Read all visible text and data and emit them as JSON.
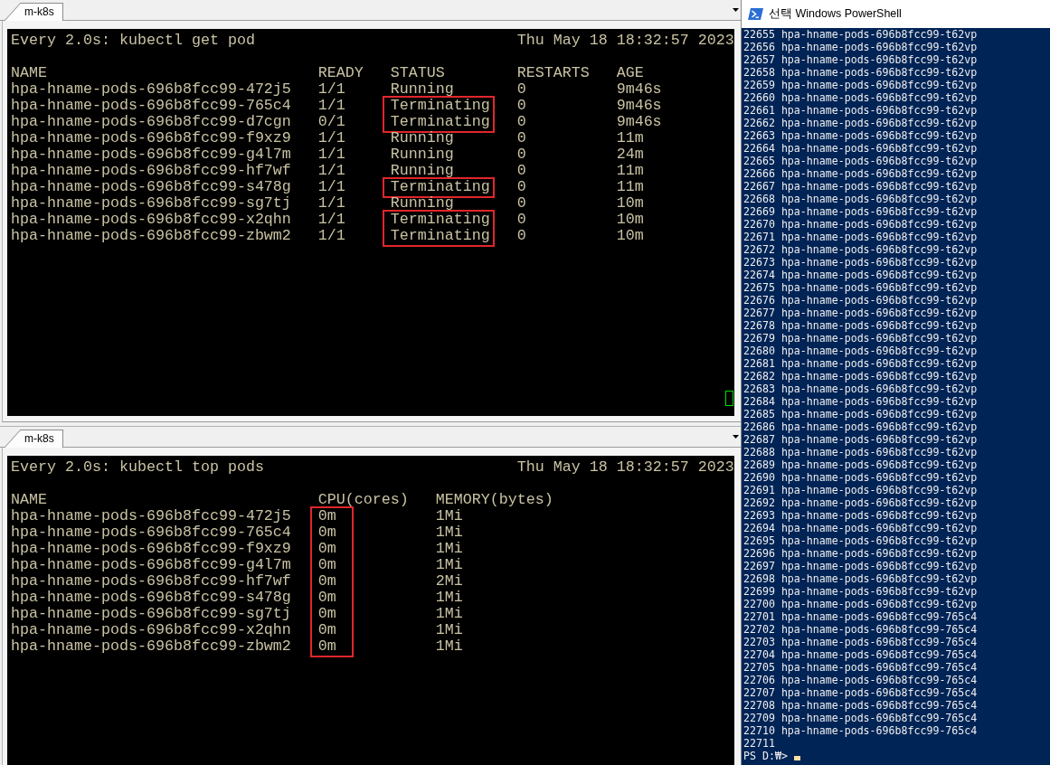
{
  "panes": [
    {
      "tab": "m-k8s",
      "command": "Every 2.0s: kubectl get pod",
      "timestamp": "Thu May 18 18:32:57 2023",
      "cursor_visible": true,
      "columns": [
        "NAME",
        "READY",
        "STATUS",
        "RESTARTS",
        "AGE"
      ],
      "rows": [
        {
          "cells": [
            "hpa-hname-pods-696b8fcc99-472j5",
            "1/1",
            "Running",
            "0",
            "9m46s"
          ],
          "highlighted": [
            false,
            false,
            false,
            false,
            false
          ]
        },
        {
          "cells": [
            "hpa-hname-pods-696b8fcc99-765c4",
            "1/1",
            "Terminating",
            "0",
            "9m46s"
          ],
          "highlighted": [
            false,
            false,
            true,
            false,
            false
          ]
        },
        {
          "cells": [
            "hpa-hname-pods-696b8fcc99-d7cgn",
            "0/1",
            "Terminating",
            "0",
            "9m46s"
          ],
          "highlighted": [
            false,
            false,
            true,
            false,
            false
          ]
        },
        {
          "cells": [
            "hpa-hname-pods-696b8fcc99-f9xz9",
            "1/1",
            "Running",
            "0",
            "11m"
          ],
          "highlighted": [
            false,
            false,
            false,
            false,
            false
          ]
        },
        {
          "cells": [
            "hpa-hname-pods-696b8fcc99-g4l7m",
            "1/1",
            "Running",
            "0",
            "24m"
          ],
          "highlighted": [
            false,
            false,
            false,
            false,
            false
          ]
        },
        {
          "cells": [
            "hpa-hname-pods-696b8fcc99-hf7wf",
            "1/1",
            "Running",
            "0",
            "11m"
          ],
          "highlighted": [
            false,
            false,
            false,
            false,
            false
          ]
        },
        {
          "cells": [
            "hpa-hname-pods-696b8fcc99-s478g",
            "1/1",
            "Terminating",
            "0",
            "11m"
          ],
          "highlighted": [
            false,
            false,
            true,
            false,
            false
          ]
        },
        {
          "cells": [
            "hpa-hname-pods-696b8fcc99-sg7tj",
            "1/1",
            "Running",
            "0",
            "10m"
          ],
          "highlighted": [
            false,
            false,
            false,
            false,
            false
          ]
        },
        {
          "cells": [
            "hpa-hname-pods-696b8fcc99-x2qhn",
            "1/1",
            "Terminating",
            "0",
            "10m"
          ],
          "highlighted": [
            false,
            false,
            true,
            false,
            false
          ]
        },
        {
          "cells": [
            "hpa-hname-pods-696b8fcc99-zbwm2",
            "1/1",
            "Terminating",
            "0",
            "10m"
          ],
          "highlighted": [
            false,
            false,
            true,
            false,
            false
          ]
        }
      ]
    },
    {
      "tab": "m-k8s",
      "command": "Every 2.0s: kubectl top pods",
      "timestamp": "Thu May 18 18:32:57 2023",
      "cursor_visible": false,
      "columns": [
        "NAME",
        "CPU(cores)",
        "MEMORY(bytes)"
      ],
      "rows": [
        {
          "cells": [
            "hpa-hname-pods-696b8fcc99-472j5",
            "0m",
            "1Mi"
          ],
          "highlighted": [
            false,
            true,
            false
          ]
        },
        {
          "cells": [
            "hpa-hname-pods-696b8fcc99-765c4",
            "0m",
            "1Mi"
          ],
          "highlighted": [
            false,
            true,
            false
          ]
        },
        {
          "cells": [
            "hpa-hname-pods-696b8fcc99-f9xz9",
            "0m",
            "1Mi"
          ],
          "highlighted": [
            false,
            true,
            false
          ]
        },
        {
          "cells": [
            "hpa-hname-pods-696b8fcc99-g4l7m",
            "0m",
            "1Mi"
          ],
          "highlighted": [
            false,
            true,
            false
          ]
        },
        {
          "cells": [
            "hpa-hname-pods-696b8fcc99-hf7wf",
            "0m",
            "2Mi"
          ],
          "highlighted": [
            false,
            true,
            false
          ]
        },
        {
          "cells": [
            "hpa-hname-pods-696b8fcc99-s478g",
            "0m",
            "1Mi"
          ],
          "highlighted": [
            false,
            true,
            false
          ]
        },
        {
          "cells": [
            "hpa-hname-pods-696b8fcc99-sg7tj",
            "0m",
            "1Mi"
          ],
          "highlighted": [
            false,
            true,
            false
          ]
        },
        {
          "cells": [
            "hpa-hname-pods-696b8fcc99-x2qhn",
            "0m",
            "1Mi"
          ],
          "highlighted": [
            false,
            true,
            false
          ]
        },
        {
          "cells": [
            "hpa-hname-pods-696b8fcc99-zbwm2",
            "0m",
            "1Mi"
          ],
          "highlighted": [
            false,
            true,
            false
          ]
        }
      ]
    }
  ],
  "powershell": {
    "title": "선택 Windows PowerShell",
    "lines": [
      "22655 hpa-hname-pods-696b8fcc99-t62vp",
      "22656 hpa-hname-pods-696b8fcc99-t62vp",
      "22657 hpa-hname-pods-696b8fcc99-t62vp",
      "22658 hpa-hname-pods-696b8fcc99-t62vp",
      "22659 hpa-hname-pods-696b8fcc99-t62vp",
      "22660 hpa-hname-pods-696b8fcc99-t62vp",
      "22661 hpa-hname-pods-696b8fcc99-t62vp",
      "22662 hpa-hname-pods-696b8fcc99-t62vp",
      "22663 hpa-hname-pods-696b8fcc99-t62vp",
      "22664 hpa-hname-pods-696b8fcc99-t62vp",
      "22665 hpa-hname-pods-696b8fcc99-t62vp",
      "22666 hpa-hname-pods-696b8fcc99-t62vp",
      "22667 hpa-hname-pods-696b8fcc99-t62vp",
      "22668 hpa-hname-pods-696b8fcc99-t62vp",
      "22669 hpa-hname-pods-696b8fcc99-t62vp",
      "22670 hpa-hname-pods-696b8fcc99-t62vp",
      "22671 hpa-hname-pods-696b8fcc99-t62vp",
      "22672 hpa-hname-pods-696b8fcc99-t62vp",
      "22673 hpa-hname-pods-696b8fcc99-t62vp",
      "22674 hpa-hname-pods-696b8fcc99-t62vp",
      "22675 hpa-hname-pods-696b8fcc99-t62vp",
      "22676 hpa-hname-pods-696b8fcc99-t62vp",
      "22677 hpa-hname-pods-696b8fcc99-t62vp",
      "22678 hpa-hname-pods-696b8fcc99-t62vp",
      "22679 hpa-hname-pods-696b8fcc99-t62vp",
      "22680 hpa-hname-pods-696b8fcc99-t62vp",
      "22681 hpa-hname-pods-696b8fcc99-t62vp",
      "22682 hpa-hname-pods-696b8fcc99-t62vp",
      "22683 hpa-hname-pods-696b8fcc99-t62vp",
      "22684 hpa-hname-pods-696b8fcc99-t62vp",
      "22685 hpa-hname-pods-696b8fcc99-t62vp",
      "22686 hpa-hname-pods-696b8fcc99-t62vp",
      "22687 hpa-hname-pods-696b8fcc99-t62vp",
      "22688 hpa-hname-pods-696b8fcc99-t62vp",
      "22689 hpa-hname-pods-696b8fcc99-t62vp",
      "22690 hpa-hname-pods-696b8fcc99-t62vp",
      "22691 hpa-hname-pods-696b8fcc99-t62vp",
      "22692 hpa-hname-pods-696b8fcc99-t62vp",
      "22693 hpa-hname-pods-696b8fcc99-t62vp",
      "22694 hpa-hname-pods-696b8fcc99-t62vp",
      "22695 hpa-hname-pods-696b8fcc99-t62vp",
      "22696 hpa-hname-pods-696b8fcc99-t62vp",
      "22697 hpa-hname-pods-696b8fcc99-t62vp",
      "22698 hpa-hname-pods-696b8fcc99-t62vp",
      "22699 hpa-hname-pods-696b8fcc99-t62vp",
      "22700 hpa-hname-pods-696b8fcc99-t62vp",
      "22701 hpa-hname-pods-696b8fcc99-765c4",
      "22702 hpa-hname-pods-696b8fcc99-765c4",
      "22703 hpa-hname-pods-696b8fcc99-765c4",
      "22704 hpa-hname-pods-696b8fcc99-765c4",
      "22705 hpa-hname-pods-696b8fcc99-765c4",
      "22706 hpa-hname-pods-696b8fcc99-765c4",
      "22707 hpa-hname-pods-696b8fcc99-765c4",
      "22708 hpa-hname-pods-696b8fcc99-765c4",
      "22709 hpa-hname-pods-696b8fcc99-765c4",
      "22710 hpa-hname-pods-696b8fcc99-765c4",
      "22711"
    ],
    "prompt": "PS D:₩>"
  }
}
